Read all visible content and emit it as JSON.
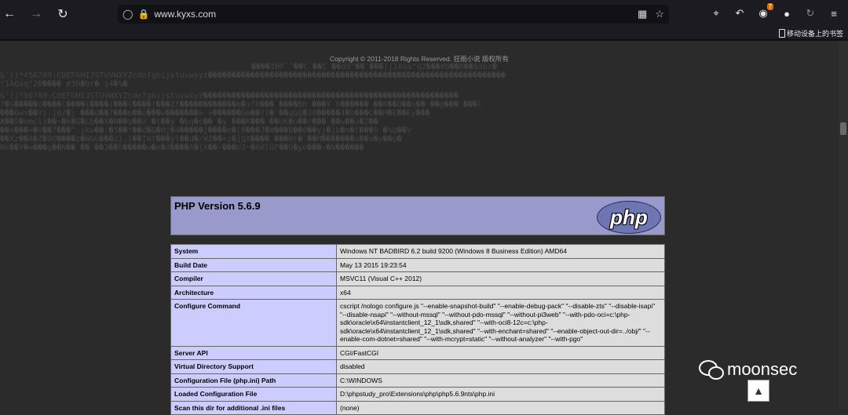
{
  "browser": {
    "url": "www.kyxs.com",
    "extension_badge": "7",
    "mobile_bookmarks": "移动设备上的书签"
  },
  "page": {
    "copyright": "Copyright © 2011-2018 Rights Reserved. 狂雨小说 版权所有",
    "garbled_lines": [
      "����IHF``��C    ��C    ��dd\"��`���||1AQa\"q2���#B��R��$3br�",
      "&'()*456789:CDEFGHIJSTUVWXYZcdefghijstuvwxyz���������������������������������������������������������������",
      "                                                  !1AQaq\"2B����  #3R�br�   $4�%�",
      "     &'()*56789:CDEFGHIJSTUVWXYZcdefghijstuvwxyz������������������������������������������������������",
      " ?�S�����(����(����(����(���(����(���Zf������������m�sfh��� ����Bh ���Y h������ ��K��Q��s�� ��@��� ���l",
      "  ���Qwx��Y}.j0/�; ���d��7���m��o���w�������= =������Gm��7(� ��qGQ�38�����4�h���C��H�E��Ey���",
      "Ж��S�omcli��~�k�G�Lb��X�N��u��x �t��y �Ƅq�c�� �y ���K��� ��UK�o��c��� ��w��u�Z��",
      "��x���+�V��7���^ jkw��:�5��*��d�&�Hj�4�����j����e�(R���J�W���B��0��yj�jb�n�t���9 �%@��V",
      "��Xz��A�Z�9O����z�WGG���z}.(��IWI���yl��d�/WZ��+z�]QX���� ���Wr�  ��M�������x��a�y��@�",
      "Nk��Y�=���g��N�� �� ��3��h�����w�e�d����A�{X��~���UJ~�0#[UF��Q�yo���~�N������"
    ],
    "php_title": "PHP Version 5.6.9",
    "php_logo_text": "php",
    "rows": [
      {
        "label": "System",
        "value": "Windows NT BADBIRD 6.2 build 9200 (Windows 8 Business Edition) AMD64"
      },
      {
        "label": "Build Date",
        "value": "May 13 2015 19:23:54"
      },
      {
        "label": "Compiler",
        "value": "MSVC11 (Visual C++ 2012)"
      },
      {
        "label": "Architecture",
        "value": "x64"
      },
      {
        "label": "Configure Command",
        "value": "cscript /nologo configure.js \"--enable-snapshot-build\" \"--enable-debug-pack\" \"--disable-zts\" \"--disable-isapi\" \"--disable-nsapi\" \"--without-mssql\" \"--without-pdo-mssql\" \"--without-pi3web\" \"--with-pdo-oci=c:\\php-sdk\\oracle\\x64\\instantclient_12_1\\sdk,shared\" \"--with-oci8-12c=c:\\php-sdk\\oracle\\x64\\instantclient_12_1\\sdk,shared\" \"--with-enchant=shared\" \"--enable-object-out-dir=../obj/\" \"--enable-com-dotnet=shared\" \"--with-mcrypt=static\" \"--without-analyzer\" \"--with-pgo\""
      },
      {
        "label": "Server API",
        "value": "CGI/FastCGI"
      },
      {
        "label": "Virtual Directory Support",
        "value": "disabled"
      },
      {
        "label": "Configuration File (php.ini) Path",
        "value": "C:\\WINDOWS"
      },
      {
        "label": "Loaded Configuration File",
        "value": "D:\\phpstudy_pro\\Extensions\\php\\php5.6.9nts\\php.ini"
      },
      {
        "label": "Scan this dir for additional .ini files",
        "value": "(none)"
      }
    ]
  },
  "watermark": {
    "text": "moonsec"
  }
}
